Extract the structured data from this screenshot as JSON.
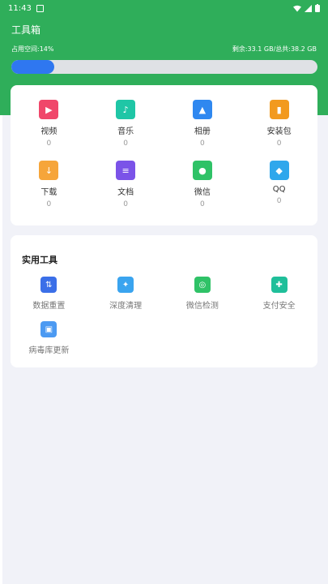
{
  "status": {
    "time": "11:43"
  },
  "header": {
    "title": "工具箱",
    "used": "占用空间:14%",
    "capacity": "剩余:33.1 GB/总共:38.2 GB",
    "progress_percent": 14
  },
  "colors": {
    "header_bg": "#2fae5a",
    "progress": "#2f77f0"
  },
  "files": [
    {
      "label": "视频",
      "count": "0",
      "icon": "video-icon",
      "color": "#f0476a"
    },
    {
      "label": "音乐",
      "count": "0",
      "icon": "music-icon",
      "color": "#1fc6a6"
    },
    {
      "label": "相册",
      "count": "0",
      "icon": "album-icon",
      "color": "#2f88f0"
    },
    {
      "label": "安装包",
      "count": "0",
      "icon": "package-icon",
      "color": "#f29a1f"
    },
    {
      "label": "下载",
      "count": "0",
      "icon": "download-icon",
      "color": "#f6a53a"
    },
    {
      "label": "文档",
      "count": "0",
      "icon": "document-icon",
      "color": "#7b53e8"
    },
    {
      "label": "微信",
      "count": "0",
      "icon": "wechat-icon",
      "color": "#2fc267"
    },
    {
      "label": "QQ",
      "count": "0",
      "icon": "qq-icon",
      "color": "#2fa7ec"
    }
  ],
  "tools": {
    "title": "实用工具",
    "items": [
      {
        "label": "数据重置",
        "icon": "data-reset-icon",
        "color": "#3b6fe8"
      },
      {
        "label": "深度清理",
        "icon": "deep-clean-icon",
        "color": "#3aa4ef"
      },
      {
        "label": "微信检测",
        "icon": "wechat-check-icon",
        "color": "#2fc267"
      },
      {
        "label": "支付安全",
        "icon": "payment-security-icon",
        "color": "#1fbf9a"
      },
      {
        "label": "病毒库更新",
        "icon": "virus-update-icon",
        "color": "#4c9af2"
      }
    ]
  }
}
